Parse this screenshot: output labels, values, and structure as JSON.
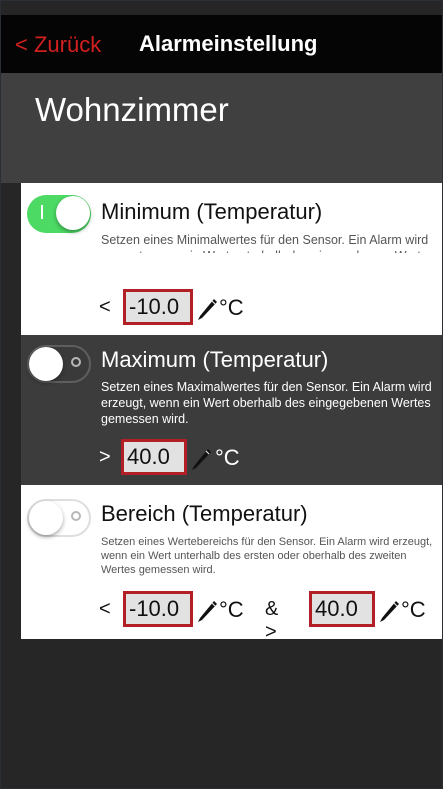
{
  "nav": {
    "back_label": "< Zurück",
    "title": "Alarmeinstellung"
  },
  "room": {
    "title": "Wohnzimmer"
  },
  "minimum": {
    "enabled": true,
    "title": "Minimum (Temperatur)",
    "description": "Setzen eines Minimalwertes für den Sensor. Ein Alarm wird erzeugt, wenn ein Wert unterhalb des eingegebenen Wertes gemessen wird.",
    "operator": "<",
    "value": "-10.0",
    "unit": "°C"
  },
  "maximum": {
    "enabled": false,
    "title": "Maximum (Temperatur)",
    "description": "Setzen eines Maximalwertes für den Sensor. Ein Alarm wird erzeugt, wenn ein Wert oberhalb des eingegebenen Wertes gemessen wird.",
    "operator": ">",
    "value": "40.0",
    "unit": "°C"
  },
  "range": {
    "enabled": false,
    "title": "Bereich (Temperatur)",
    "description": "Setzen eines Wertebereichs für den Sensor. Ein Alarm wird erzeugt, wenn ein Wert unterhalb des ersten oder oberhalb des zweiten Wertes gemessen wird.",
    "operator_low": "<",
    "value_low": "-10.0",
    "unit_low": "°C",
    "joiner": "& >",
    "value_high": "40.0",
    "unit_high": "°C"
  },
  "icons": {
    "pencil": "pencil-icon"
  },
  "colors": {
    "accent_red": "#d21f1f",
    "box_border": "#b21f24",
    "toggle_on": "#4cd964",
    "navbar_bg": "#050505",
    "header_bg": "#404040",
    "dark_card_bg": "#3c3c3c"
  }
}
